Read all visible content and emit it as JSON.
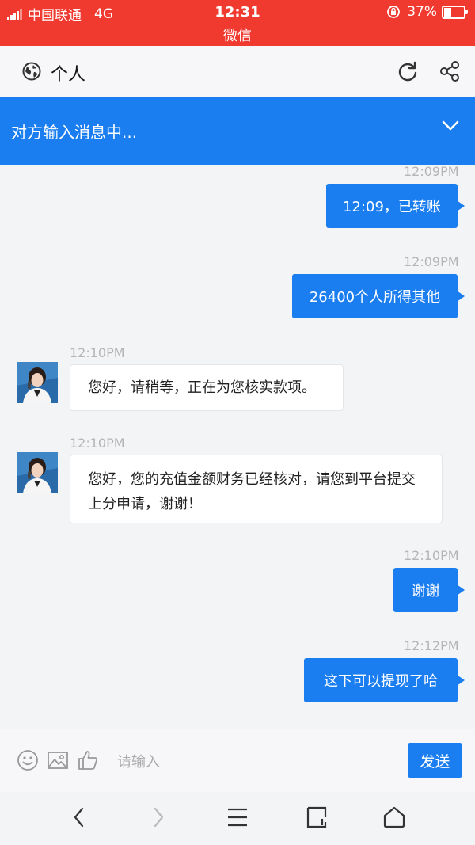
{
  "status_bar": {
    "carrier": "中国联通",
    "network": "4G",
    "time": "12:31",
    "battery": "37%",
    "app_title": "微信"
  },
  "header": {
    "title": "个人",
    "icons": [
      "globe-icon",
      "refresh-icon",
      "share-icon"
    ]
  },
  "typing_bar": {
    "text": "对方输入消息中...",
    "icon": "chevron-down-icon"
  },
  "messages": [
    {
      "direction": "out",
      "time": "12:09PM",
      "text": "12:09，已转账"
    },
    {
      "direction": "out",
      "time": "12:09PM",
      "text": "26400个人所得其他"
    },
    {
      "direction": "in",
      "time": "12:10PM",
      "text": "您好，请稍等，正在为您核实款项。"
    },
    {
      "direction": "in",
      "time": "12:10PM",
      "text": "您好，您的充值金额财务已经核对，请您到平台提交上分申请，谢谢！"
    },
    {
      "direction": "out",
      "time": "12:10PM",
      "text": "谢谢"
    },
    {
      "direction": "out",
      "time": "12:12PM",
      "text": "这下可以提现了哈"
    }
  ],
  "input_bar": {
    "placeholder": "请输入",
    "send_label": "发送",
    "icons": [
      "emoji-icon",
      "image-icon",
      "thumbs-up-icon"
    ]
  },
  "nav_bar": {
    "icons": [
      "back-icon",
      "forward-icon",
      "menu-icon",
      "tabs-icon",
      "home-icon"
    ]
  },
  "colors": {
    "status_bar": "#f03a30",
    "accent": "#1a7df0",
    "background": "#f3f4f6"
  }
}
